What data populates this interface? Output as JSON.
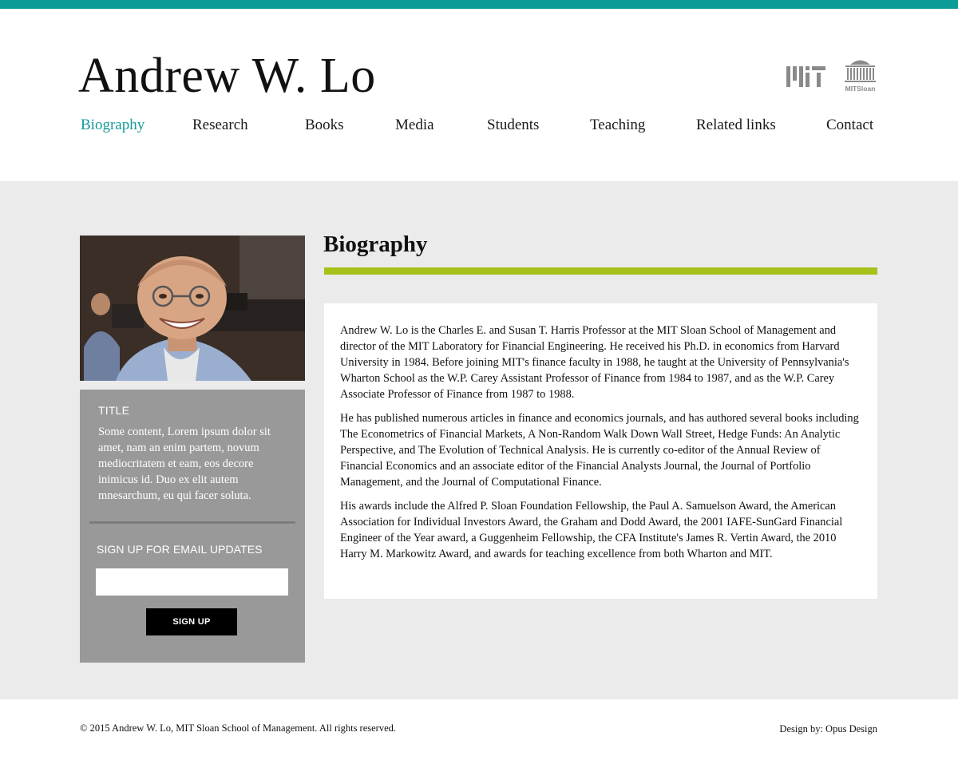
{
  "header": {
    "site_title": "Andrew W. Lo",
    "sloan_logo_text": "MITSloan",
    "accent_color": "#0c9c97"
  },
  "nav": {
    "items": [
      {
        "label": "Biography",
        "active": true
      },
      {
        "label": "Research"
      },
      {
        "label": "Books"
      },
      {
        "label": "Media"
      },
      {
        "label": "Students"
      },
      {
        "label": "Teaching"
      },
      {
        "label": "Related links"
      },
      {
        "label": "Contact"
      }
    ]
  },
  "sidebar": {
    "title": "TITLE",
    "text": "Some content, Lorem ipsum dolor sit amet, nam an enim partem, novum mediocritatem et eam, eos decore inimicus id. Duo ex elit autem mnesarchum, eu qui facer soluta.",
    "signup_title": "SIGN UP FOR EMAIL UPDATES",
    "email_value": "",
    "signup_button": "SIGN UP"
  },
  "main": {
    "heading": "Biography",
    "rule_color": "#a8c01a",
    "paragraphs": [
      "Andrew W. Lo is the Charles E. and Susan T. Harris Professor at the MIT Sloan School of Management and director of the MIT Laboratory for Financial Engineering. He received his Ph.D. in economics from Harvard University in 1984. Before joining MIT's finance faculty in 1988, he taught at the University of Pennsylvania's Wharton School as the W.P. Carey Assistant Professor of Finance from 1984 to 1987, and as the W.P. Carey Associate Professor of Finance from 1987 to 1988.",
      "He has published numerous articles in finance and economics journals, and has authored several books including The Econometrics of Financial Markets, A Non-Random Walk Down Wall Street, Hedge Funds: An Analytic Perspective, and The Evolution of Technical Analysis. He is currently co-editor of the Annual Review of Financial Economics and an associate editor of the Financial Analysts Journal, the Journal of Portfolio Management, and the Journal of Computational Finance.",
      "His awards include the Alfred P. Sloan Foundation Fellowship, the Paul A. Samuelson Award, the American Association for Individual Investors Award, the Graham and Dodd Award, the 2001 IAFE-SunGard Financial Engineer of the Year award, a Guggenheim Fellowship, the CFA Institute's James R. Vertin Award, the 2010 Harry M. Markowitz Award, and awards for teaching excellence from both Wharton and MIT."
    ]
  },
  "footer": {
    "copyright": "© 2015 Andrew W. Lo, MIT Sloan School of Management. All rights reserved.",
    "design_credit": "Design by: Opus Design"
  }
}
